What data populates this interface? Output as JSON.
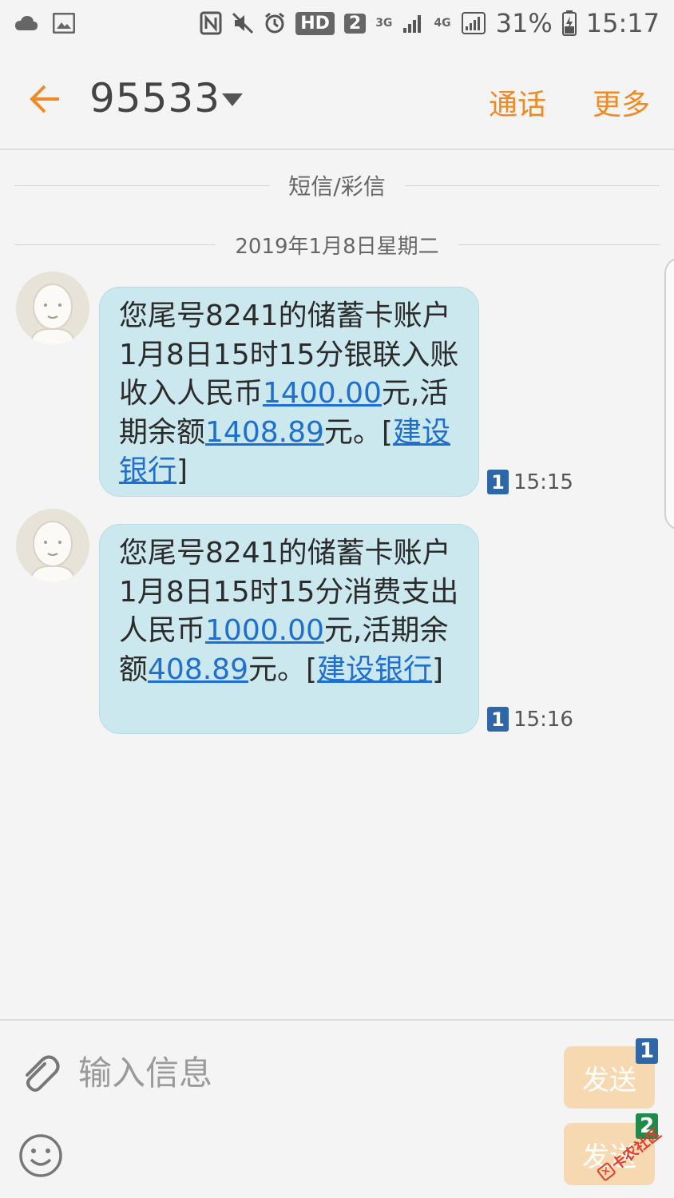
{
  "status_bar": {
    "hd": "HD",
    "sim": "2",
    "net1": "3G",
    "net2": "4G",
    "battery": "31%",
    "time": "15:17",
    "icons": [
      "cloud-icon",
      "gallery-icon",
      "nfc-icon",
      "mute-icon",
      "alarm-icon",
      "signal-icon",
      "battery-icon"
    ]
  },
  "header": {
    "title": "95533",
    "call_label": "通话",
    "more_label": "更多",
    "accent_color": "#f08a24"
  },
  "dividers": {
    "type": "短信/彩信",
    "date": "2019年1月8日星期二"
  },
  "messages": [
    {
      "parts": [
        {
          "text": "您尾号8241的储蓄卡账户1月8日15时15分银联入账收入人民币",
          "link": false
        },
        {
          "text": "1400.00",
          "link": true
        },
        {
          "text": "元,活期余额",
          "link": false
        },
        {
          "text": "1408.89",
          "link": true
        },
        {
          "text": "元。[",
          "link": false
        },
        {
          "text": "建设银行",
          "link": true
        },
        {
          "text": "]",
          "link": false
        }
      ],
      "sim": "1",
      "time": "15:15"
    },
    {
      "parts": [
        {
          "text": "您尾号8241的储蓄卡账户1月8日15时15分消费支出人民币",
          "link": false
        },
        {
          "text": "1000.00",
          "link": true
        },
        {
          "text": "元,活期余额",
          "link": false
        },
        {
          "text": "408.89",
          "link": true
        },
        {
          "text": "元。[",
          "link": false
        },
        {
          "text": "建设银行",
          "link": true
        },
        {
          "text": "]",
          "link": false
        }
      ],
      "sim": "1",
      "time": "15:16"
    }
  ],
  "composer": {
    "placeholder": "输入信息",
    "send_label_1": "发送",
    "send_label_2": "发送",
    "send_sim_1": "1",
    "send_sim_2": "2",
    "watermark": "卡农社区"
  },
  "colors": {
    "bubble": "#cce8ef",
    "link": "#1e6fd0",
    "send_disabled": "#f6d9b1",
    "sim1": "#2f66a8",
    "sim2": "#1f8a4a"
  }
}
